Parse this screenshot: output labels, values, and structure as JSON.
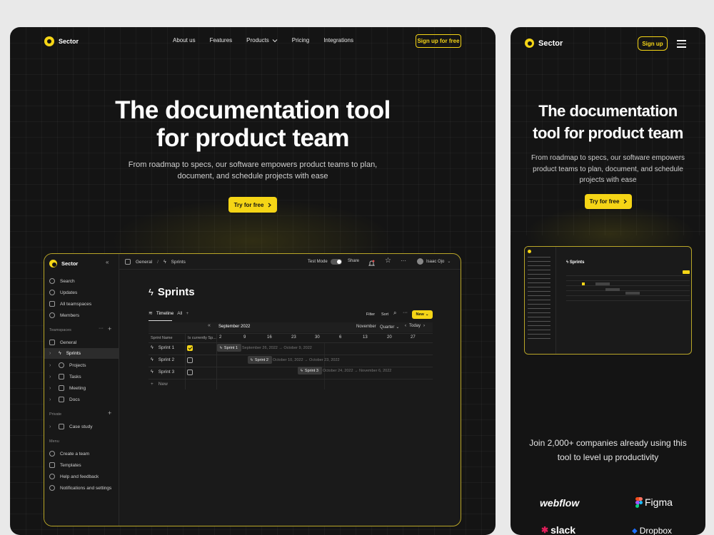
{
  "desktop": {
    "logo": "Sector",
    "nav": [
      "About us",
      "Features",
      "Products",
      "Pricing",
      "Integrations"
    ],
    "cta": "Sign up for free",
    "hero_title_line1": "The documentation tool",
    "hero_title_line2": "for product team",
    "hero_sub_line1": "From roadmap to specs, our software empowers product teams to plan,",
    "hero_sub_line2": "document, and schedule projects with ease",
    "try_btn": "Try for free"
  },
  "app": {
    "logo": "Sector",
    "breadcrumb_root": "General",
    "breadcrumb_sep": "/",
    "breadcrumb_page": "Sprints",
    "test_mode": "Test Mode",
    "share": "Share",
    "user": "Isaac Ojo",
    "side_top": [
      "Search",
      "Updates",
      "All teamspaces",
      "Members"
    ],
    "teamspaces_label": "Teamspaces",
    "teamspaces": [
      "General",
      "Sprints",
      "Projects",
      "Tasks",
      "Meeting",
      "Docs"
    ],
    "private_label": "Private",
    "private_items": [
      "Case study"
    ],
    "menu_label": "Menu",
    "menu_items": [
      "Create a team",
      "Templates",
      "Help and feedback",
      "Notifications and settings"
    ],
    "page_title": "Sprints",
    "view_tab": "Timeline",
    "view_all": "All",
    "filter": "Filter",
    "sort": "Sort",
    "new_btn": "New",
    "month": "September 2022",
    "month2": "November",
    "quarter": "Quarter",
    "today": "Today",
    "col_name": "Sprint Name",
    "col_current": "Is currently Sp...",
    "days": [
      "2",
      "9",
      "16",
      "23",
      "30",
      "6",
      "13",
      "20",
      "27"
    ],
    "rows": [
      {
        "name": "Sprint 1",
        "checked": true,
        "bar": "Sprint 1",
        "dates": "September 26, 2022 → October 9, 2022"
      },
      {
        "name": "Sprint 2",
        "checked": false,
        "bar": "Sprint 2",
        "dates": "October 10, 2022 → October 23, 2022"
      },
      {
        "name": "Sprint 3",
        "checked": false,
        "bar": "Sprint 3",
        "dates": "October 24, 2022 → November 6, 2022"
      }
    ],
    "new_row": "New"
  },
  "mobile": {
    "logo": "Sector",
    "cta": "Sign up",
    "hero_title_line1": "The documentation",
    "hero_title_line2": "tool for product team",
    "hero_sub_line1": "From roadmap to specs, our software empowers",
    "hero_sub_line2": "product teams to plan, document, and schedule",
    "hero_sub_line3": "projects with ease",
    "try_btn": "Try for free",
    "social_line1": "Join 2,000+ companies already using this",
    "social_line2": "tool to level up productivity",
    "brands": [
      "webflow",
      "Figma",
      "slack",
      "Dropbox"
    ]
  },
  "colors": {
    "accent": "#f5d516",
    "bg": "#141414",
    "page": "#e9e9e9"
  }
}
